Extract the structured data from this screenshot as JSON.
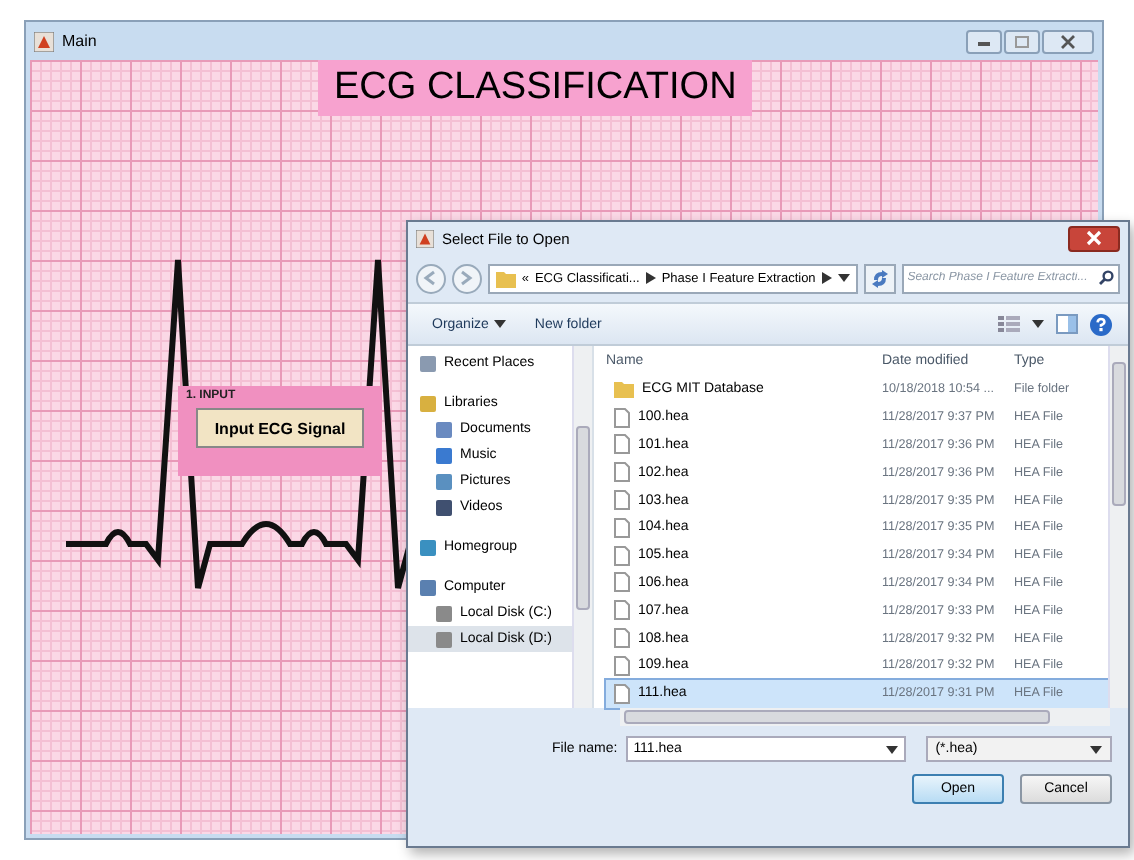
{
  "window": {
    "title": "Main",
    "heading": "ECG CLASSIFICATION"
  },
  "input_panel": {
    "title": "1. INPUT",
    "button": "Input ECG Signal"
  },
  "dialog": {
    "title": "Select File to Open",
    "breadcrumb_overflow": "«",
    "breadcrumb": [
      "ECG Classificati...",
      "Phase I Feature Extraction"
    ],
    "search": {
      "placeholder": "Search Phase I Feature Extracti..."
    },
    "toolbar": [
      {
        "label": "Organize",
        "dropdown": true
      },
      {
        "label": "New folder",
        "dropdown": false
      }
    ],
    "sidebar": [
      {
        "label": "Recent Places",
        "kind": "recent",
        "selected": false
      },
      {
        "label": "Libraries",
        "kind": "library",
        "selected": false,
        "children": [
          {
            "label": "Documents",
            "kind": "documents",
            "selected": false
          },
          {
            "label": "Music",
            "kind": "music",
            "selected": false
          },
          {
            "label": "Pictures",
            "kind": "pictures",
            "selected": false
          },
          {
            "label": "Videos",
            "kind": "videos",
            "selected": false
          }
        ]
      },
      {
        "label": "Homegroup",
        "kind": "homegroup",
        "selected": false
      },
      {
        "label": "Computer",
        "kind": "computer",
        "selected": false,
        "children": [
          {
            "label": "Local Disk (C:)",
            "kind": "disk",
            "selected": false
          },
          {
            "label": "Local Disk (D:)",
            "kind": "disk",
            "selected": true
          }
        ]
      }
    ],
    "columns": [
      "Name",
      "Date modified",
      "Type"
    ],
    "rows": [
      {
        "name": "ECG MIT Database",
        "date": "10/18/2018 10:54 ...",
        "type": "File folder",
        "kind": "folder",
        "selected": false
      },
      {
        "name": "100.hea",
        "date": "11/28/2017 9:37 PM",
        "type": "HEA File",
        "kind": "file",
        "selected": false
      },
      {
        "name": "101.hea",
        "date": "11/28/2017 9:36 PM",
        "type": "HEA File",
        "kind": "file",
        "selected": false
      },
      {
        "name": "102.hea",
        "date": "11/28/2017 9:36 PM",
        "type": "HEA File",
        "kind": "file",
        "selected": false
      },
      {
        "name": "103.hea",
        "date": "11/28/2017 9:35 PM",
        "type": "HEA File",
        "kind": "file",
        "selected": false
      },
      {
        "name": "104.hea",
        "date": "11/28/2017 9:35 PM",
        "type": "HEA File",
        "kind": "file",
        "selected": false
      },
      {
        "name": "105.hea",
        "date": "11/28/2017 9:34 PM",
        "type": "HEA File",
        "kind": "file",
        "selected": false
      },
      {
        "name": "106.hea",
        "date": "11/28/2017 9:34 PM",
        "type": "HEA File",
        "kind": "file",
        "selected": false
      },
      {
        "name": "107.hea",
        "date": "11/28/2017 9:33 PM",
        "type": "HEA File",
        "kind": "file",
        "selected": false
      },
      {
        "name": "108.hea",
        "date": "11/28/2017 9:32 PM",
        "type": "HEA File",
        "kind": "file",
        "selected": false
      },
      {
        "name": "109.hea",
        "date": "11/28/2017 9:32 PM",
        "type": "HEA File",
        "kind": "file",
        "selected": false
      },
      {
        "name": "111.hea",
        "date": "11/28/2017 9:31 PM",
        "type": "HEA File",
        "kind": "file",
        "selected": true
      }
    ],
    "file_name": {
      "label": "File name:",
      "value": "111.hea"
    },
    "file_type": "(*.hea)",
    "buttons": [
      {
        "label": "Open",
        "primary": true
      },
      {
        "label": "Cancel",
        "primary": false
      }
    ]
  }
}
